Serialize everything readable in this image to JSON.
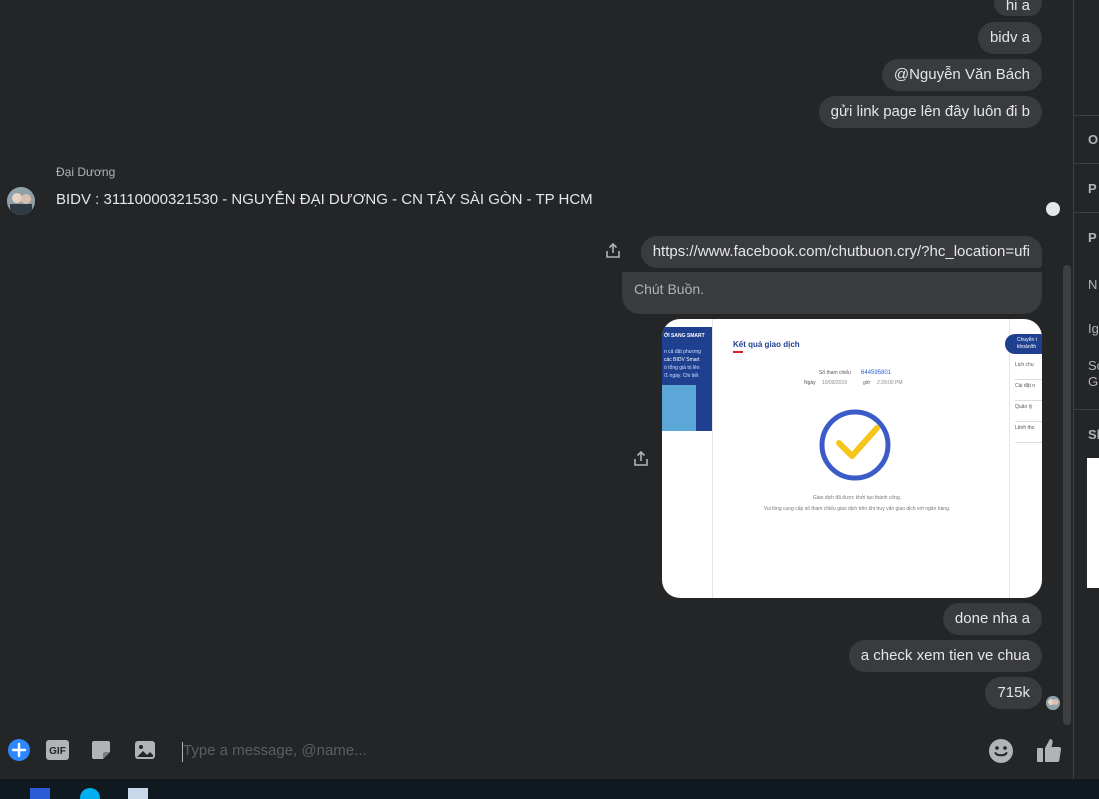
{
  "messages": {
    "m0": "hi a",
    "m1": "bidv a",
    "m2": "@Nguyễn Văn Bách",
    "m3": "gửi link page lên đây luôn đi b",
    "sender": "Đại Dương",
    "m4": "BIDV : 31110000321530 - NGUYỄN ĐẠI DƯƠNG - CN TÂY SÀI GÒN - TP HCM",
    "link": "https://www.facebook.com/chutbuon.cry/?hc_location=ufi",
    "link_title": "Chút Buồn.",
    "m5": "done nha a",
    "m6": "a check xem tien ve chua",
    "m7": "715k"
  },
  "receipt": {
    "banner_title": "ỚI SANG SMART",
    "banner_line1": "n cả đặt phương",
    "banner_line2": "các BIDV Smart",
    "banner_line3": "ó tổng giá trị lên",
    "banner_line4": "/1 ngày. Chi tiết",
    "title": "Kết quả giao dịch",
    "ref_label": "Số tham chiếu",
    "ref_value": "644595801",
    "date_label": "Ngày",
    "date_value": "10/09/2019",
    "time_label": "giờ",
    "time_value": "2:29:00 PM",
    "success_line1": "Giao dịch đã được khởi tạo thành công.",
    "success_line2": "Vui lòng cung cấp số tham chiếu giao dịch trên khi truy vấn giao dịch với ngân hàng.",
    "side_header1": "Chuyển t",
    "side_header2": "khoản/th",
    "side_items": [
      "Lịch chu",
      "Cài đặt n",
      "Quản lý",
      "Lệnh tho"
    ]
  },
  "right_pane": {
    "labels": [
      "O",
      "P",
      "P",
      "N",
      "Ig",
      "Sc",
      "Gi",
      "Sh"
    ]
  },
  "composer": {
    "placeholder": "Type a message, @name..."
  },
  "colors": {
    "background": "#242526",
    "bubble": "#3a3b3c",
    "accent": "#2d88ff",
    "receipt_blue": "#1f3f8f",
    "receipt_check": "#f5c518"
  }
}
